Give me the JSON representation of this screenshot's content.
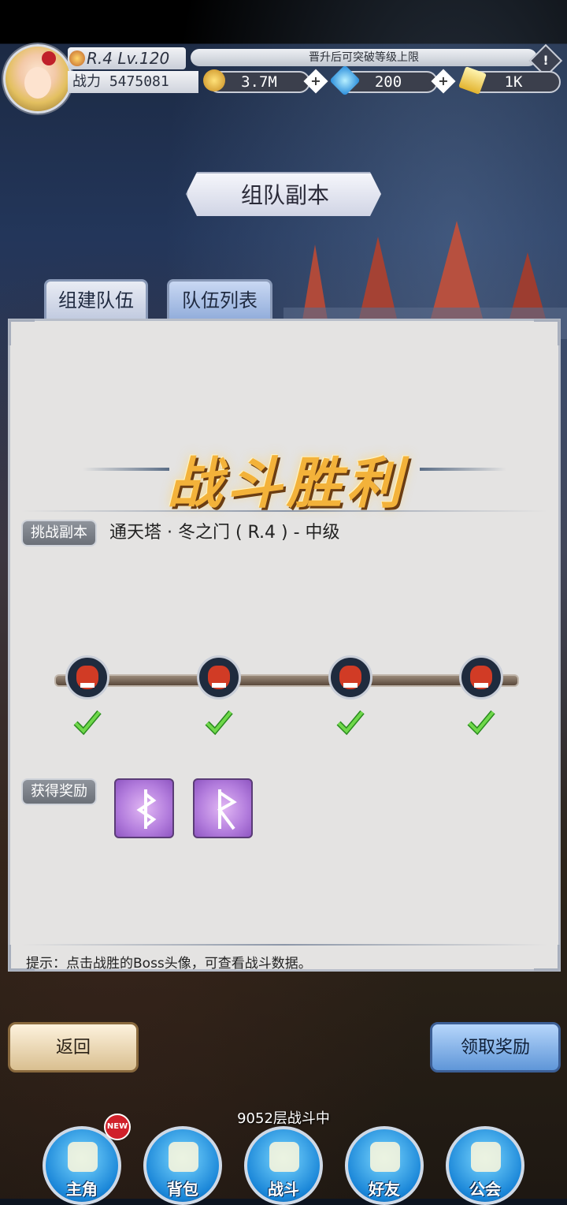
{
  "player": {
    "rank_level": "R.4 Lv.120",
    "power_label": "战力",
    "power_value": "5475081",
    "rank_hint": "晋升后可突破等级上限"
  },
  "currency": {
    "gold": "3.7M",
    "gem": "200",
    "crystal": "1K"
  },
  "screen": {
    "title": "组队副本"
  },
  "tabs": [
    "组建队伍",
    "队伍列表"
  ],
  "result": {
    "victory_text": "战斗胜利",
    "challenge_label": "挑战副本",
    "dungeon_name": "通天塔 · 冬之门 ( R.4 ) - 中级",
    "bosses_cleared": [
      true,
      true,
      true,
      true
    ],
    "rewards_label": "获得奖励",
    "rewards": [
      "rune-b-icon",
      "rune-r-icon"
    ],
    "tip": "提示：点击战胜的Boss头像，可查看战斗数据。"
  },
  "buttons": {
    "back": "返回",
    "claim": "领取奖励"
  },
  "status": {
    "floor": "9052层战斗中"
  },
  "nav": {
    "items": [
      {
        "label": "主角",
        "icon": "hero-helmet-icon"
      },
      {
        "label": "背包",
        "icon": "backpack-icon"
      },
      {
        "label": "战斗",
        "icon": "crossed-swords-icon"
      },
      {
        "label": "好友",
        "icon": "handshake-icon"
      },
      {
        "label": "公会",
        "icon": "guild-crest-icon"
      }
    ],
    "new_badge": "NEW"
  }
}
